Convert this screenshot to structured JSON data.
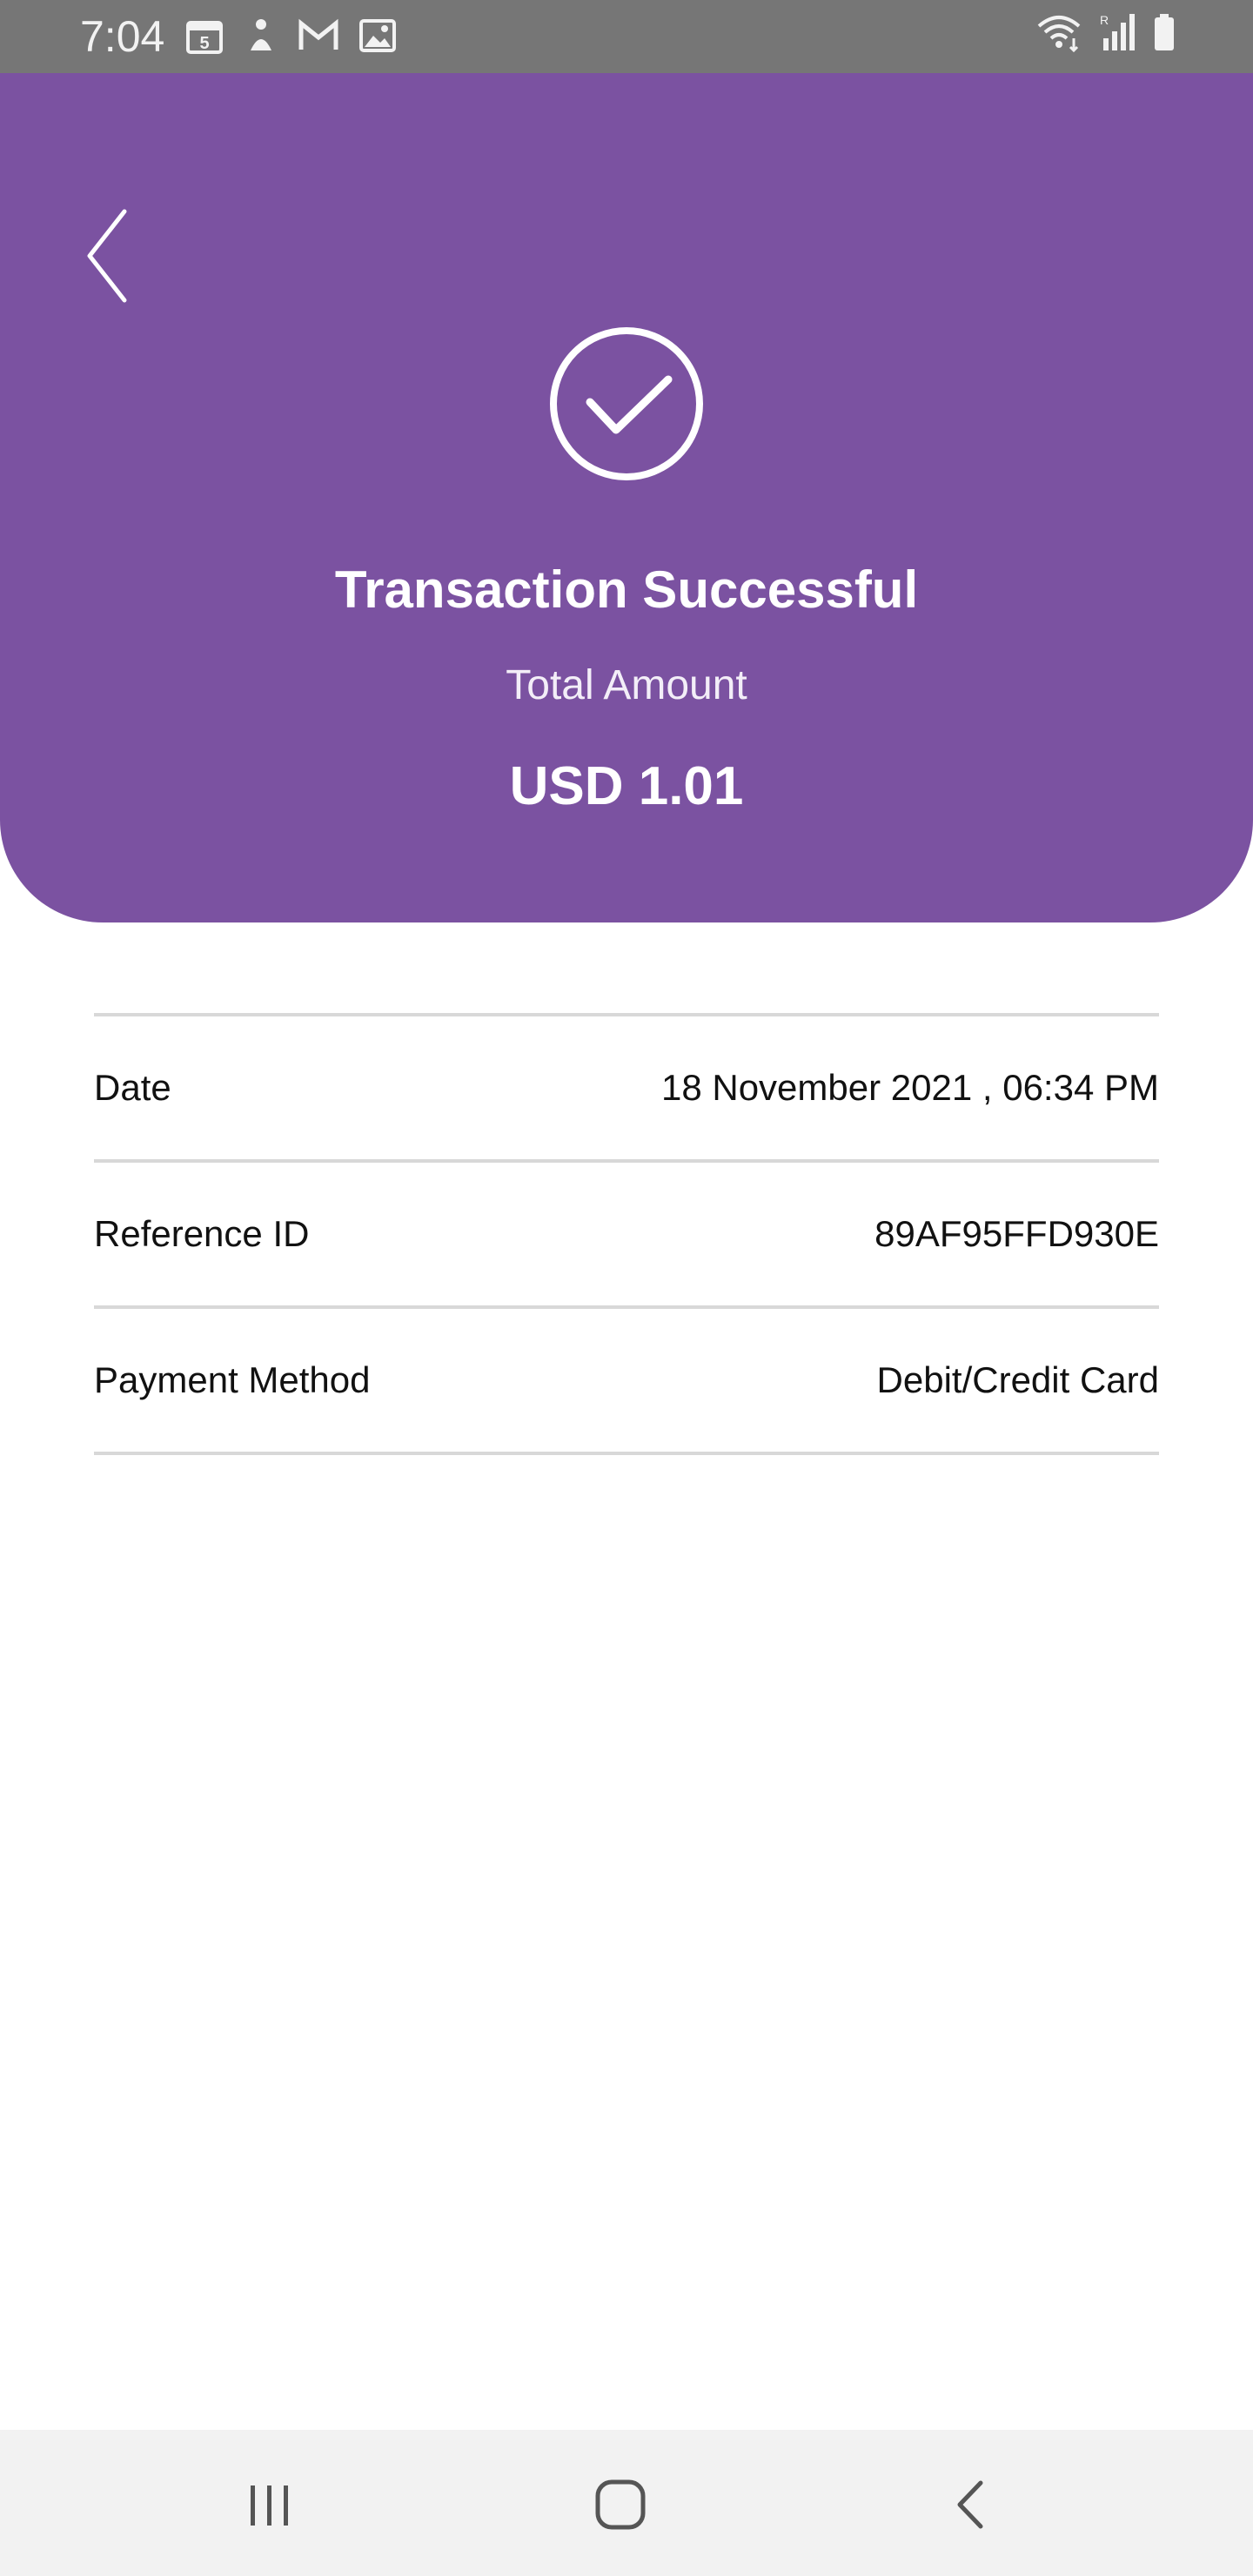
{
  "status_bar": {
    "time": "7:04",
    "left_icons": [
      "calendar-icon",
      "notification-app-icon",
      "gmail-icon",
      "gallery-icon"
    ],
    "right_icons": [
      "wifi-icon",
      "signal-icon",
      "battery-icon"
    ]
  },
  "header": {
    "background_color": "#7b52a1",
    "title": "Transaction Successful",
    "subtitle": "Total Amount",
    "amount": "USD 1.01"
  },
  "details": {
    "rows": [
      {
        "label": "Date",
        "value": "18 November 2021 , 06:34 PM"
      },
      {
        "label": "Reference ID",
        "value": "89AF95FFD930E"
      },
      {
        "label": "Payment Method",
        "value": "Debit/Credit Card"
      }
    ]
  },
  "nav_bar": {
    "buttons": [
      "recents-icon",
      "home-icon",
      "back-icon"
    ]
  }
}
